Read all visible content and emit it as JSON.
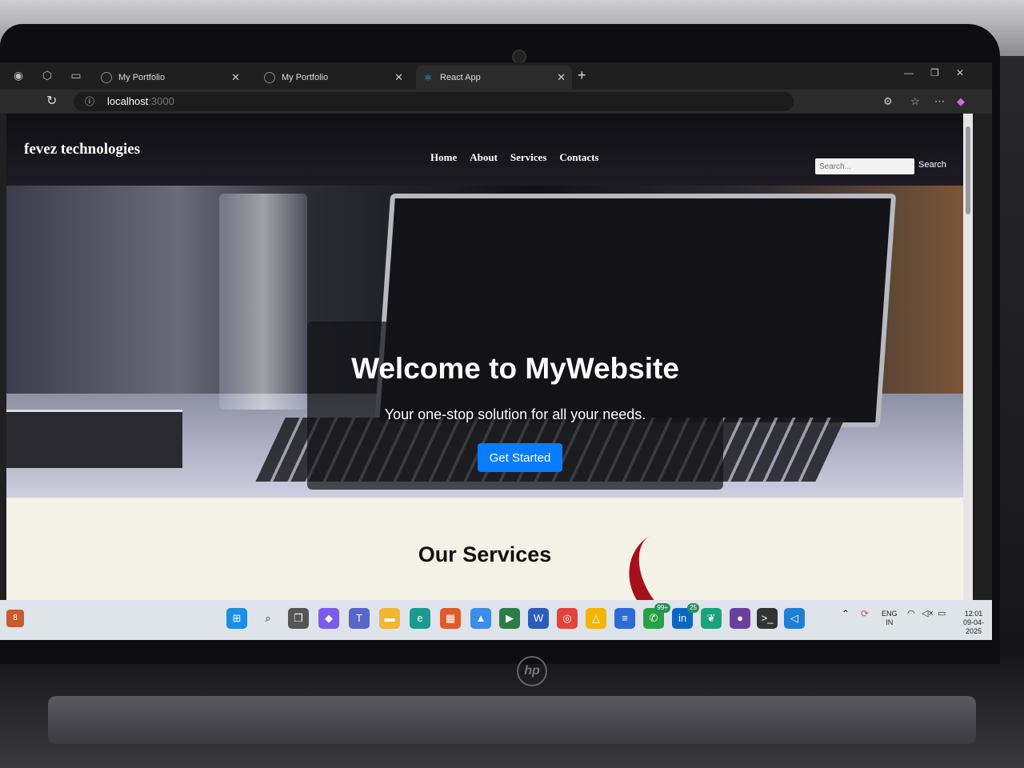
{
  "browser": {
    "tabs": [
      {
        "title": "My Portfolio",
        "favicon": "globe-icon"
      },
      {
        "title": "My Portfolio",
        "favicon": "globe-icon"
      },
      {
        "title": "React App",
        "favicon": "react-icon"
      }
    ],
    "active_tab": 2,
    "url_host": "localhost",
    "url_port": ":3000"
  },
  "site": {
    "brand": "fevez technologies",
    "nav": [
      "Home",
      "About",
      "Services",
      "Contacts"
    ],
    "search_placeholder": "Search...",
    "search_button": "Search",
    "hero_title": "Welcome to MyWebsite",
    "hero_subtitle": "Your one-stop solution for all your needs.",
    "cta_label": "Get Started",
    "services_title": "Our Services",
    "accent_color": "#0a7cff"
  },
  "taskbar": {
    "widget_badge": "8",
    "whatsapp_badge": "99+",
    "linkedin_badge": "25",
    "language": "ENG",
    "region": "IN",
    "time": "12:01",
    "date": "09-04-2025"
  }
}
